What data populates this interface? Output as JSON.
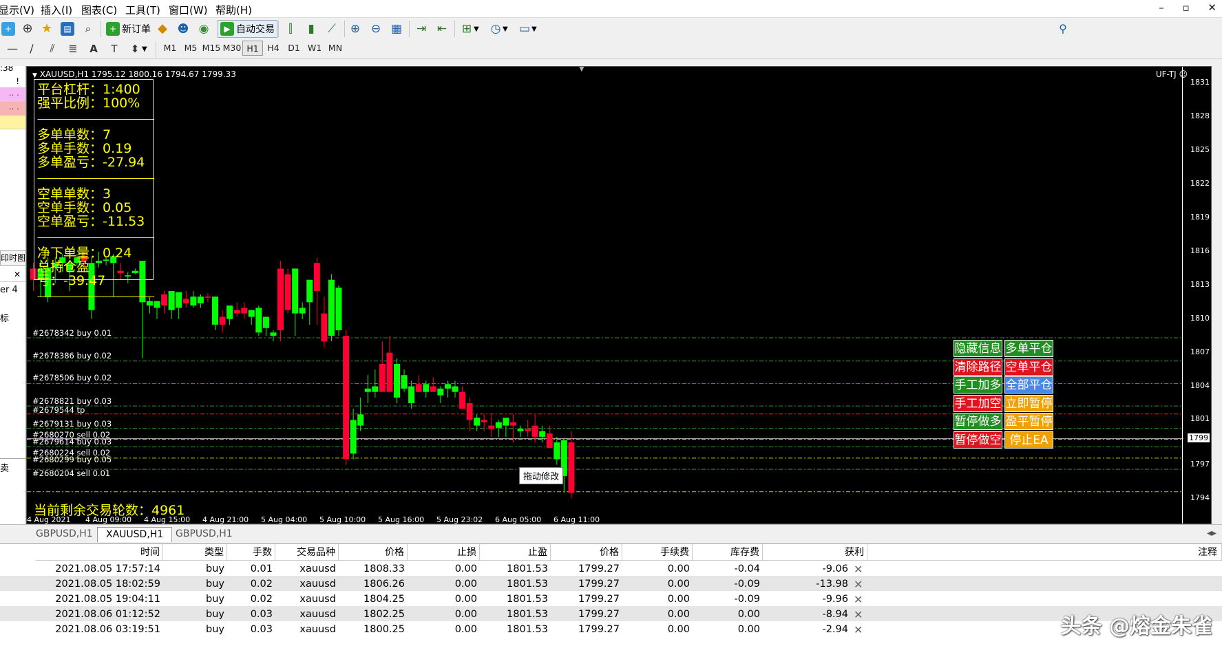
{
  "menu": {
    "items": [
      "显示(V)",
      "插入(I)",
      "图表(C)",
      "工具(T)",
      "窗口(W)",
      "帮助(H)"
    ],
    "win_min": "–",
    "win_max": "▫",
    "win_close": "✕"
  },
  "toolbar": {
    "new_order": "新订单",
    "auto_trade": "自动交易"
  },
  "timeframes": [
    "M1",
    "M5",
    "M15",
    "M30",
    "H1",
    "H4",
    "D1",
    "W1",
    "MN"
  ],
  "selected_timeframe": "H1",
  "left_panel": {
    "time": ":38",
    "row_excl": "!",
    "tip_text": "印时图",
    "close_x": "✕",
    "expert": "er 4",
    "tick": "标",
    "bottom": "卖"
  },
  "chart": {
    "title": "XAUUSD,H1  1795.12 1800.16 1794.67 1799.33",
    "ea_name": "UF-TJ ☺",
    "info": {
      "leverage": "平台杠杆：1:400",
      "stopout": "强平比例：100%",
      "long_count": "多单单数：7",
      "long_lots": "多单手数：0.19",
      "long_pl": "多单盈亏：-27.94",
      "short_count": "空单单数：3",
      "short_lots": "空单手数：0.05",
      "short_pl": "空单盈亏：-11.53",
      "net_lots": "净下单量：0.24",
      "total_pl": "总持仓盈亏：-39.47",
      "dash": "---------------------------------------------------"
    },
    "rounds": "当前剩余交易轮数：4961",
    "drag_tip": "拖动修改",
    "order_labels": [
      "#2678342 buy 0.01",
      "#2678386 buy 0.02",
      "#2678506 buy 0.02",
      "#2678821 buy 0.03",
      "#2679544 tp",
      "#2679131 buy 0.03",
      "#2680270 sell 0.02",
      "#2679614 buy 0.03",
      "#2680224 sell 0.02",
      "#2680299 buy 0.05",
      "#2680204 sell 0.01"
    ],
    "buttons": [
      {
        "label": "隐藏信息",
        "color": "#1f8f1f"
      },
      {
        "label": "多单平仓",
        "color": "#1f8f1f"
      },
      {
        "label": "清除路径",
        "color": "#e0141e"
      },
      {
        "label": "空单平仓",
        "color": "#e0141e"
      },
      {
        "label": "手工加多",
        "color": "#1f8f1f"
      },
      {
        "label": "全部平仓",
        "color": "#4a86e8"
      },
      {
        "label": "手工加空",
        "color": "#e0141e"
      },
      {
        "label": "立即暂停",
        "color": "#f0a000"
      },
      {
        "label": "暂停做多",
        "color": "#1f8f1f"
      },
      {
        "label": "盈平暂停",
        "color": "#f0a000"
      },
      {
        "label": "暂停做空",
        "color": "#e0141e"
      },
      {
        "label": "停止EA",
        "color": "#f0a000"
      }
    ],
    "y_ticks": [
      "1831",
      "1828",
      "1825",
      "1822",
      "1819",
      "1816",
      "1813",
      "1810",
      "1807",
      "1804",
      "1801",
      "1799",
      "1797",
      "1794"
    ],
    "x_ticks": [
      "4 Aug 2021",
      "4 Aug 09:00",
      "4 Aug 15:00",
      "4 Aug 21:00",
      "5 Aug 04:00",
      "5 Aug 10:00",
      "5 Aug 16:00",
      "5 Aug 23:02",
      "6 Aug 05:00",
      "6 Aug 11:00"
    ]
  },
  "tabs": [
    "GBPUSD,H1",
    "XAUUSD,H1",
    "GBPUSD,H1"
  ],
  "active_tab": "XAUUSD,H1",
  "table": {
    "headers": [
      "时间",
      "类型",
      "手数",
      "交易品种",
      "价格",
      "止损",
      "止盈",
      "价格",
      "手续费",
      "库存费",
      "获利",
      "注释"
    ],
    "rows": [
      [
        "2021.08.05 17:57:14",
        "buy",
        "0.01",
        "xauusd",
        "1808.33",
        "0.00",
        "1801.53",
        "1799.27",
        "0.00",
        "-0.04",
        "-9.06"
      ],
      [
        "2021.08.05 18:02:59",
        "buy",
        "0.02",
        "xauusd",
        "1806.26",
        "0.00",
        "1801.53",
        "1799.27",
        "0.00",
        "-0.09",
        "-13.98"
      ],
      [
        "2021.08.05 19:04:11",
        "buy",
        "0.02",
        "xauusd",
        "1804.25",
        "0.00",
        "1801.53",
        "1799.27",
        "0.00",
        "-0.09",
        "-9.96"
      ],
      [
        "2021.08.06 01:12:52",
        "buy",
        "0.03",
        "xauusd",
        "1802.25",
        "0.00",
        "1801.53",
        "1799.27",
        "0.00",
        "0.00",
        "-8.94"
      ],
      [
        "2021.08.06 03:19:51",
        "buy",
        "0.03",
        "xauusd",
        "1800.25",
        "0.00",
        "1801.53",
        "1799.27",
        "0.00",
        "0.00",
        "-2.94"
      ]
    ]
  },
  "watermark": "头条 @熔金朱雀",
  "chart_data": {
    "type": "candlestick",
    "symbol": "XAUUSD",
    "timeframe": "H1",
    "ylim": [
      1792.5,
      1832.5
    ],
    "order_lines": [
      1808.33,
      1806.26,
      1804.25,
      1802.25,
      1801.53,
      1800.25,
      1799.27,
      1798.6,
      1797.6,
      1796.6,
      1794.6
    ],
    "candles": [
      [
        1814.5,
        1815.0,
        1812.5,
        1813.5
      ],
      [
        1813.5,
        1815.3,
        1812.0,
        1814.5
      ],
      [
        1812.0,
        1815.5,
        1811.5,
        1814.6
      ],
      [
        1814.6,
        1815.5,
        1813.2,
        1815.0
      ],
      [
        1815.0,
        1815.8,
        1814.2,
        1815.5
      ],
      [
        1814.3,
        1815.3,
        1812.5,
        1815.0
      ],
      [
        1815.0,
        1815.8,
        1814.8,
        1815.5
      ],
      [
        1815.6,
        1816.0,
        1814.5,
        1815.2
      ],
      [
        1810.8,
        1815.5,
        1810.0,
        1815.0
      ],
      [
        1815.0,
        1816.0,
        1814.6,
        1815.2
      ],
      [
        1815.2,
        1815.5,
        1814.8,
        1815.3
      ],
      [
        1815.0,
        1815.8,
        1812.0,
        1815.6
      ],
      [
        1814.3,
        1815.0,
        1813.5,
        1814.1
      ],
      [
        1813.8,
        1814.2,
        1813.2,
        1813.9
      ],
      [
        1814.1,
        1814.5,
        1814.0,
        1814.3
      ],
      [
        1811.5,
        1815.0,
        1806.5,
        1815.2
      ],
      [
        1811.2,
        1812.0,
        1810.5,
        1811.6
      ],
      [
        1811.0,
        1811.5,
        1810.0,
        1811.6
      ],
      [
        1812.2,
        1812.5,
        1810.5,
        1811.2
      ],
      [
        1810.8,
        1812.5,
        1810.0,
        1812.5
      ],
      [
        1811.0,
        1812.0,
        1810.0,
        1812.4
      ],
      [
        1811.8,
        1812.5,
        1811.0,
        1811.4
      ],
      [
        1811.2,
        1812.5,
        1811.0,
        1812.0
      ],
      [
        1811.4,
        1812.2,
        1811.0,
        1812.0
      ],
      [
        1812.0,
        1812.3,
        1811.5,
        1811.9
      ],
      [
        1809.5,
        1812.0,
        1809.0,
        1812.0
      ],
      [
        1810.2,
        1810.8,
        1808.8,
        1809.5
      ],
      [
        1810.0,
        1811.0,
        1809.5,
        1811.2
      ],
      [
        1810.8,
        1811.5,
        1810.2,
        1810.5
      ],
      [
        1811.0,
        1811.5,
        1810.0,
        1810.5
      ],
      [
        1810.2,
        1810.8,
        1809.5,
        1810.8
      ],
      [
        1808.8,
        1811.2,
        1808.5,
        1811.0
      ],
      [
        1809.2,
        1810.0,
        1808.5,
        1810.2
      ],
      [
        1808.5,
        1809.0,
        1808.0,
        1808.8
      ],
      [
        1814.5,
        1815.2,
        1808.0,
        1809.0
      ],
      [
        1814.0,
        1814.5,
        1810.5,
        1810.8
      ],
      [
        1810.5,
        1814.5,
        1808.5,
        1814.5
      ],
      [
        1810.5,
        1811.5,
        1810.0,
        1811.0
      ],
      [
        1811.5,
        1813.5,
        1809.5,
        1813.5
      ],
      [
        1815.0,
        1815.5,
        1809.5,
        1812.5
      ],
      [
        1810.5,
        1812.0,
        1807.5,
        1808.0
      ],
      [
        1808.5,
        1814.0,
        1808.0,
        1813.5
      ],
      [
        1809.0,
        1813.0,
        1808.5,
        1812.8
      ],
      [
        1808.5,
        1809.0,
        1797.0,
        1797.5
      ],
      [
        1798.0,
        1802.0,
        1797.5,
        1801.0
      ],
      [
        1800.5,
        1803.0,
        1800.0,
        1801.5
      ],
      [
        1803.5,
        1805.0,
        1802.5,
        1803.8
      ],
      [
        1803.5,
        1805.5,
        1803.0,
        1804.0
      ],
      [
        1806.0,
        1808.0,
        1805.5,
        1803.5
      ],
      [
        1807.0,
        1808.5,
        1805.5,
        1803.5
      ],
      [
        1803.0,
        1806.5,
        1802.5,
        1806.0
      ],
      [
        1803.8,
        1805.5,
        1803.5,
        1805.0
      ],
      [
        1802.5,
        1804.5,
        1802.0,
        1804.0
      ],
      [
        1804.2,
        1805.0,
        1803.5,
        1803.5
      ],
      [
        1803.5,
        1804.5,
        1803.0,
        1804.2
      ],
      [
        1804.0,
        1804.8,
        1803.5,
        1803.5
      ],
      [
        1803.2,
        1804.0,
        1802.5,
        1803.8
      ],
      [
        1803.8,
        1804.5,
        1803.0,
        1804.2
      ],
      [
        1803.5,
        1804.5,
        1803.0,
        1804.0
      ],
      [
        1803.5,
        1804.0,
        1802.0,
        1802.0
      ],
      [
        1802.5,
        1803.0,
        1800.0,
        1801.0
      ],
      [
        1800.5,
        1801.5,
        1800.0,
        1801.2
      ],
      [
        1801.0,
        1801.5,
        1800.0,
        1800.8
      ],
      [
        1800.5,
        1801.5,
        1799.5,
        1800.2
      ],
      [
        1800.3,
        1801.0,
        1799.5,
        1800.8
      ],
      [
        1800.5,
        1801.0,
        1799.5,
        1801.2
      ],
      [
        1800.8,
        1801.5,
        1799.0,
        1800.5
      ],
      [
        1800.0,
        1800.5,
        1799.5,
        1800.2
      ],
      [
        1800.2,
        1801.0,
        1799.5,
        1800.0
      ],
      [
        1800.5,
        1801.5,
        1799.0,
        1799.5
      ],
      [
        1799.5,
        1800.5,
        1799.0,
        1800.0
      ],
      [
        1799.8,
        1800.5,
        1798.5,
        1798.5
      ],
      [
        1797.5,
        1799.5,
        1797.0,
        1799.0
      ],
      [
        1796.0,
        1799.0,
        1794.5,
        1799.2
      ],
      [
        1799.0,
        1800.0,
        1794.0,
        1794.5
      ]
    ]
  }
}
